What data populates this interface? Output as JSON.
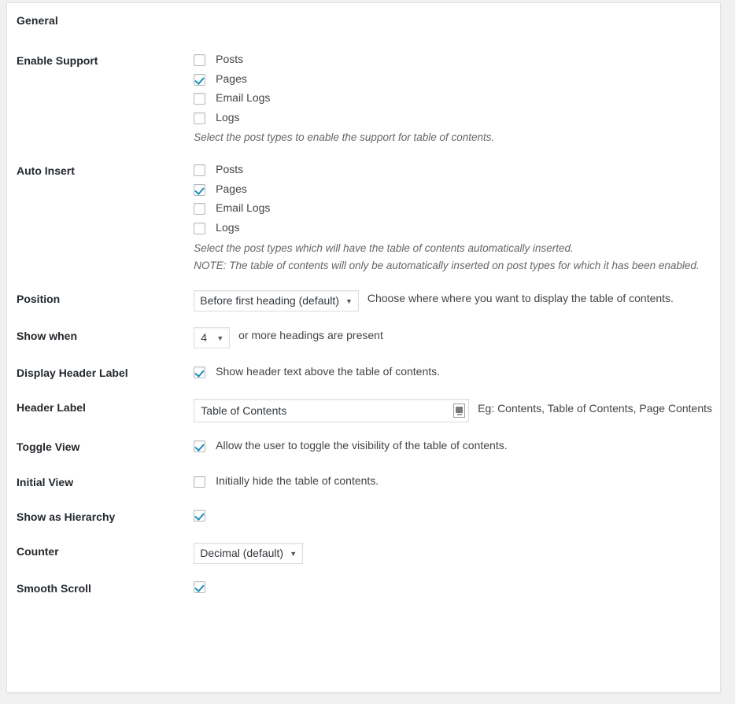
{
  "section": {
    "title": "General"
  },
  "rows": {
    "enable_support": {
      "label": "Enable Support",
      "options": [
        {
          "label": "Posts",
          "checked": false
        },
        {
          "label": "Pages",
          "checked": true
        },
        {
          "label": "Email Logs",
          "checked": false
        },
        {
          "label": "Logs",
          "checked": false
        }
      ],
      "description": "Select the post types to enable the support for table of contents."
    },
    "auto_insert": {
      "label": "Auto Insert",
      "options": [
        {
          "label": "Posts",
          "checked": false
        },
        {
          "label": "Pages",
          "checked": true
        },
        {
          "label": "Email Logs",
          "checked": false
        },
        {
          "label": "Logs",
          "checked": false
        }
      ],
      "description": "Select the post types which will have the table of contents automatically inserted.",
      "note": "NOTE: The table of contents will only be automatically inserted on post types for which it has been enabled."
    },
    "position": {
      "label": "Position",
      "value": "Before first heading (default)",
      "description": "Choose where where you want to display the table of contents."
    },
    "show_when": {
      "label": "Show when",
      "value": "4",
      "description": "or more headings are present"
    },
    "display_header_label": {
      "label": "Display Header Label",
      "checked": true,
      "description": "Show header text above the table of contents."
    },
    "header_label": {
      "label": "Header Label",
      "value": "Table of Contents",
      "placeholder": "Table of Contents",
      "description": "Eg: Contents, Table of Contents, Page Contents"
    },
    "toggle_view": {
      "label": "Toggle View",
      "checked": true,
      "description": "Allow the user to toggle the visibility of the table of contents."
    },
    "initial_view": {
      "label": "Initial View",
      "checked": false,
      "description": "Initially hide the table of contents."
    },
    "show_as_hierarchy": {
      "label": "Show as Hierarchy",
      "checked": true,
      "description": ""
    },
    "counter": {
      "label": "Counter",
      "value": "Decimal (default)"
    },
    "smooth_scroll": {
      "label": "Smooth Scroll",
      "checked": true,
      "description": ""
    }
  },
  "icons": {
    "dropdown_arrow": "▼",
    "header_label_input_icon": "insert-media-icon"
  },
  "colors": {
    "checkmark": "#1e8cbe",
    "label_text": "#23282d",
    "body_text": "#444444",
    "description_text": "#666666",
    "panel_background": "#ffffff",
    "page_background": "#f1f1f1",
    "border": "#e2e2e2"
  }
}
